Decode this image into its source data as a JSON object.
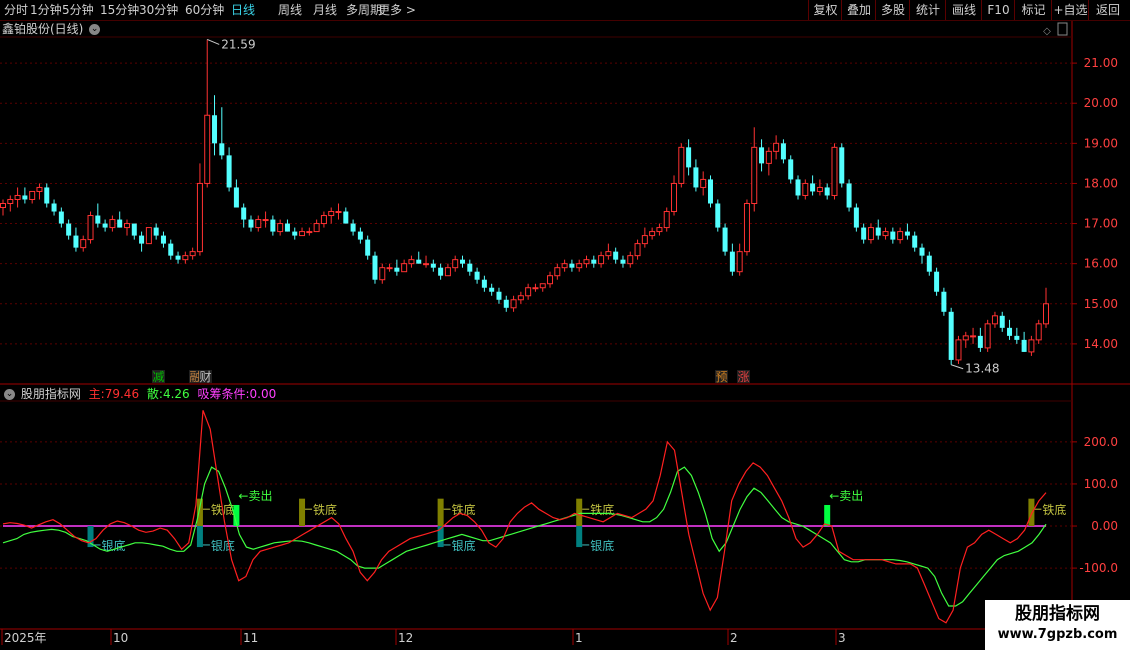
{
  "toolbar": {
    "periods": [
      "分时",
      "1分钟",
      "5分钟",
      "15分钟",
      "30分钟",
      "60分钟",
      "日线",
      "周线",
      "月线",
      "多周期",
      "更多 >"
    ],
    "active_period": "日线",
    "actions": [
      "复权",
      "叠加",
      "多股",
      "统计",
      "画线",
      "F10",
      "标记",
      "+自选",
      "返回"
    ]
  },
  "main_header": {
    "title": "鑫铂股份(日线)"
  },
  "price_axis": {
    "ticks": [
      "21.00",
      "20.00",
      "19.00",
      "18.00",
      "17.00",
      "16.00",
      "15.00",
      "14.00"
    ]
  },
  "price_labels": {
    "high": "21.59",
    "low": "13.48"
  },
  "event_markers": [
    {
      "text": "减",
      "color": "#00c000"
    },
    {
      "text": "融",
      "color": "#c08040"
    },
    {
      "text": "财",
      "color": "#c0c0c0"
    },
    {
      "text": "预",
      "color": "#d08020"
    },
    {
      "text": "涨",
      "color": "#e04040"
    }
  ],
  "indicator_header": {
    "name": "股朋指标网",
    "main_label": "主:",
    "main_value": "79.46",
    "retail_label": "散:",
    "retail_value": "4.26",
    "absorb_label": "吸筹条件:",
    "absorb_value": "0.00"
  },
  "indicator_axis": {
    "ticks": [
      "200.0",
      "100.0",
      "0.00",
      "-100.0"
    ]
  },
  "indicator_labels": {
    "sell": "←卖出",
    "iron": "铁底",
    "silver": "银底"
  },
  "date_axis": {
    "labels": [
      "2025年",
      "10",
      "11",
      "12",
      "1",
      "2",
      "3"
    ]
  },
  "watermark": {
    "line1": "股朋指标网",
    "line2": "www.7gpzb.com"
  },
  "colors": {
    "up": "#ff3232",
    "down": "#54ffff",
    "main_line": "#ff2020",
    "retail_line": "#40ff40",
    "absorb_line": "#ff40ff",
    "iron_bar": "#808000",
    "silver_bar": "#008080",
    "sell_bar": "#00ff40",
    "grid": "#5a0000"
  },
  "chart_data": [
    {
      "type": "candlestick",
      "title": "鑫铂股份(日线)",
      "ylim": [
        13.0,
        22.0
      ],
      "ohlc": [
        [
          17.4,
          17.6,
          17.2,
          17.5
        ],
        [
          17.5,
          17.7,
          17.3,
          17.6
        ],
        [
          17.6,
          17.9,
          17.4,
          17.7
        ],
        [
          17.7,
          17.9,
          17.5,
          17.6
        ],
        [
          17.6,
          17.8,
          17.5,
          17.8
        ],
        [
          17.8,
          18.0,
          17.6,
          17.9
        ],
        [
          17.9,
          18.0,
          17.4,
          17.5
        ],
        [
          17.5,
          17.6,
          17.2,
          17.3
        ],
        [
          17.3,
          17.4,
          16.9,
          17.0
        ],
        [
          17.0,
          17.1,
          16.6,
          16.7
        ],
        [
          16.7,
          16.9,
          16.3,
          16.4
        ],
        [
          16.4,
          16.7,
          16.3,
          16.6
        ],
        [
          16.6,
          17.3,
          16.5,
          17.2
        ],
        [
          17.2,
          17.5,
          16.9,
          17.0
        ],
        [
          17.0,
          17.1,
          16.8,
          16.9
        ],
        [
          16.9,
          17.2,
          16.8,
          17.1
        ],
        [
          17.1,
          17.3,
          16.9,
          16.9
        ],
        [
          16.9,
          17.1,
          16.7,
          17.0
        ],
        [
          17.0,
          17.0,
          16.6,
          16.7
        ],
        [
          16.7,
          16.8,
          16.3,
          16.5
        ],
        [
          16.5,
          16.9,
          16.5,
          16.9
        ],
        [
          16.9,
          17.0,
          16.6,
          16.7
        ],
        [
          16.7,
          16.8,
          16.4,
          16.5
        ],
        [
          16.5,
          16.6,
          16.1,
          16.2
        ],
        [
          16.2,
          16.3,
          16.0,
          16.1
        ],
        [
          16.1,
          16.3,
          16.0,
          16.2
        ],
        [
          16.2,
          16.4,
          16.1,
          16.3
        ],
        [
          16.3,
          18.5,
          16.2,
          18.0
        ],
        [
          18.0,
          21.59,
          17.9,
          19.7
        ],
        [
          19.7,
          20.2,
          18.7,
          19.0
        ],
        [
          19.0,
          19.9,
          18.6,
          18.7
        ],
        [
          18.7,
          18.9,
          17.8,
          17.9
        ],
        [
          17.9,
          18.1,
          17.4,
          17.4
        ],
        [
          17.4,
          17.5,
          16.9,
          17.1
        ],
        [
          17.1,
          17.2,
          16.8,
          16.9
        ],
        [
          16.9,
          17.2,
          16.8,
          17.1
        ],
        [
          17.1,
          17.3,
          16.9,
          17.1
        ],
        [
          17.1,
          17.2,
          16.7,
          16.8
        ],
        [
          16.8,
          17.1,
          16.7,
          17.0
        ],
        [
          17.0,
          17.1,
          16.8,
          16.8
        ],
        [
          16.8,
          16.9,
          16.6,
          16.7
        ],
        [
          16.7,
          16.9,
          16.7,
          16.8
        ],
        [
          16.8,
          16.9,
          16.7,
          16.8
        ],
        [
          16.8,
          17.1,
          16.8,
          17.0
        ],
        [
          17.0,
          17.3,
          16.9,
          17.2
        ],
        [
          17.2,
          17.4,
          17.0,
          17.3
        ],
        [
          17.3,
          17.5,
          17.1,
          17.3
        ],
        [
          17.3,
          17.4,
          17.0,
          17.0
        ],
        [
          17.0,
          17.1,
          16.7,
          16.8
        ],
        [
          16.8,
          16.9,
          16.5,
          16.6
        ],
        [
          16.6,
          16.7,
          16.1,
          16.2
        ],
        [
          16.2,
          16.3,
          15.5,
          15.6
        ],
        [
          15.6,
          16.0,
          15.5,
          15.9
        ],
        [
          15.9,
          16.0,
          15.8,
          15.9
        ],
        [
          15.9,
          16.1,
          15.7,
          15.8
        ],
        [
          15.8,
          16.1,
          15.8,
          16.0
        ],
        [
          16.0,
          16.2,
          15.9,
          16.1
        ],
        [
          16.1,
          16.3,
          16.0,
          16.0
        ],
        [
          16.0,
          16.2,
          15.9,
          16.0
        ],
        [
          16.0,
          16.1,
          15.8,
          15.9
        ],
        [
          15.9,
          16.0,
          15.6,
          15.7
        ],
        [
          15.7,
          16.0,
          15.7,
          15.9
        ],
        [
          15.9,
          16.2,
          15.8,
          16.1
        ],
        [
          16.1,
          16.2,
          15.9,
          16.0
        ],
        [
          16.0,
          16.1,
          15.7,
          15.8
        ],
        [
          15.8,
          15.9,
          15.5,
          15.6
        ],
        [
          15.6,
          15.7,
          15.3,
          15.4
        ],
        [
          15.4,
          15.5,
          15.2,
          15.3
        ],
        [
          15.3,
          15.4,
          15.0,
          15.1
        ],
        [
          15.1,
          15.2,
          14.8,
          14.9
        ],
        [
          14.9,
          15.2,
          14.8,
          15.1
        ],
        [
          15.1,
          15.3,
          15.0,
          15.2
        ],
        [
          15.2,
          15.5,
          15.1,
          15.4
        ],
        [
          15.4,
          15.5,
          15.3,
          15.4
        ],
        [
          15.4,
          15.5,
          15.3,
          15.5
        ],
        [
          15.5,
          15.8,
          15.4,
          15.7
        ],
        [
          15.7,
          16.0,
          15.6,
          15.9
        ],
        [
          15.9,
          16.1,
          15.8,
          16.0
        ],
        [
          16.0,
          16.1,
          15.8,
          15.9
        ],
        [
          15.9,
          16.1,
          15.8,
          16.0
        ],
        [
          16.0,
          16.2,
          15.9,
          16.1
        ],
        [
          16.1,
          16.2,
          15.9,
          16.0
        ],
        [
          16.0,
          16.3,
          15.9,
          16.2
        ],
        [
          16.2,
          16.5,
          16.1,
          16.3
        ],
        [
          16.3,
          16.4,
          16.0,
          16.1
        ],
        [
          16.1,
          16.2,
          15.9,
          16.0
        ],
        [
          16.0,
          16.3,
          15.9,
          16.2
        ],
        [
          16.2,
          16.6,
          16.1,
          16.5
        ],
        [
          16.5,
          16.9,
          16.4,
          16.7
        ],
        [
          16.7,
          16.9,
          16.6,
          16.8
        ],
        [
          16.8,
          17.0,
          16.7,
          16.9
        ],
        [
          16.9,
          17.4,
          16.8,
          17.3
        ],
        [
          17.3,
          18.2,
          17.2,
          18.0
        ],
        [
          18.0,
          19.0,
          17.9,
          18.9
        ],
        [
          18.9,
          19.1,
          18.2,
          18.4
        ],
        [
          18.4,
          18.6,
          17.8,
          17.9
        ],
        [
          17.9,
          18.3,
          17.7,
          18.1
        ],
        [
          18.1,
          18.2,
          17.4,
          17.5
        ],
        [
          17.5,
          17.6,
          16.8,
          16.9
        ],
        [
          16.9,
          17.0,
          16.2,
          16.3
        ],
        [
          16.3,
          16.5,
          15.7,
          15.8
        ],
        [
          15.8,
          16.5,
          15.7,
          16.3
        ],
        [
          16.3,
          17.6,
          16.2,
          17.5
        ],
        [
          17.5,
          19.4,
          17.3,
          18.9
        ],
        [
          18.9,
          19.1,
          18.3,
          18.5
        ],
        [
          18.5,
          18.9,
          18.2,
          18.8
        ],
        [
          18.8,
          19.2,
          18.6,
          19.0
        ],
        [
          19.0,
          19.1,
          18.5,
          18.6
        ],
        [
          18.6,
          18.7,
          18.0,
          18.1
        ],
        [
          18.1,
          18.2,
          17.6,
          17.7
        ],
        [
          17.7,
          18.1,
          17.6,
          18.0
        ],
        [
          18.0,
          18.2,
          17.7,
          17.8
        ],
        [
          17.8,
          18.1,
          17.7,
          17.9
        ],
        [
          17.9,
          18.0,
          17.6,
          17.7
        ],
        [
          17.7,
          19.0,
          17.6,
          18.9
        ],
        [
          18.9,
          19.0,
          17.9,
          18.0
        ],
        [
          18.0,
          18.1,
          17.3,
          17.4
        ],
        [
          17.4,
          17.5,
          16.8,
          16.9
        ],
        [
          16.9,
          17.0,
          16.5,
          16.6
        ],
        [
          16.6,
          17.0,
          16.5,
          16.9
        ],
        [
          16.9,
          17.1,
          16.6,
          16.7
        ],
        [
          16.7,
          16.9,
          16.6,
          16.8
        ],
        [
          16.8,
          16.9,
          16.5,
          16.6
        ],
        [
          16.6,
          16.9,
          16.5,
          16.8
        ],
        [
          16.8,
          17.0,
          16.6,
          16.7
        ],
        [
          16.7,
          16.8,
          16.3,
          16.4
        ],
        [
          16.4,
          16.5,
          16.0,
          16.2
        ],
        [
          16.2,
          16.3,
          15.7,
          15.8
        ],
        [
          15.8,
          15.9,
          15.2,
          15.3
        ],
        [
          15.3,
          15.4,
          14.7,
          14.8
        ],
        [
          14.8,
          14.9,
          13.48,
          13.6
        ],
        [
          13.6,
          14.2,
          13.5,
          14.1
        ],
        [
          14.1,
          14.3,
          13.9,
          14.2
        ],
        [
          14.2,
          14.4,
          14.0,
          14.2
        ],
        [
          14.2,
          14.4,
          13.8,
          13.9
        ],
        [
          13.9,
          14.6,
          13.8,
          14.5
        ],
        [
          14.5,
          14.8,
          14.4,
          14.7
        ],
        [
          14.7,
          14.8,
          14.3,
          14.4
        ],
        [
          14.4,
          14.6,
          14.1,
          14.2
        ],
        [
          14.2,
          14.4,
          14.0,
          14.1
        ],
        [
          14.1,
          14.3,
          13.8,
          13.8
        ],
        [
          13.8,
          14.2,
          13.7,
          14.1
        ],
        [
          14.1,
          14.6,
          14.0,
          14.5
        ],
        [
          14.5,
          15.4,
          14.4,
          15.0
        ]
      ]
    },
    {
      "type": "line",
      "title": "股朋指标网",
      "ylim": [
        -240,
        290
      ],
      "series": [
        {
          "name": "主",
          "values": [
            5,
            8,
            6,
            2,
            -5,
            3,
            10,
            15,
            5,
            -10,
            -25,
            -35,
            -40,
            -30,
            -10,
            5,
            12,
            8,
            0,
            -10,
            -15,
            -12,
            -5,
            -10,
            -30,
            -55,
            -40,
            50,
            275,
            230,
            120,
            10,
            -80,
            -130,
            -120,
            -80,
            -60,
            -55,
            -50,
            -45,
            -40,
            -30,
            -20,
            -10,
            0,
            10,
            20,
            5,
            -30,
            -60,
            -110,
            -130,
            -110,
            -80,
            -60,
            -50,
            -40,
            -30,
            -25,
            -20,
            -15,
            -10,
            5,
            20,
            30,
            25,
            10,
            -10,
            -40,
            -50,
            -30,
            10,
            30,
            45,
            55,
            40,
            30,
            20,
            15,
            20,
            30,
            25,
            20,
            15,
            10,
            20,
            30,
            25,
            20,
            30,
            40,
            60,
            120,
            200,
            180,
            80,
            -20,
            -90,
            -160,
            -200,
            -170,
            -60,
            60,
            100,
            130,
            150,
            140,
            120,
            90,
            60,
            20,
            -30,
            -50,
            -40,
            -20,
            5,
            0,
            -60,
            -70,
            -80,
            -80,
            -80,
            -80,
            -80,
            -85,
            -90,
            -90,
            -90,
            -100,
            -140,
            -180,
            -220,
            -230,
            -200,
            -100,
            -50,
            -40,
            -20,
            -10,
            -20,
            -30,
            -40,
            -30,
            -10,
            30,
            60,
            79.46
          ]
        },
        {
          "name": "散",
          "values": [
            -40,
            -35,
            -30,
            -20,
            -15,
            -12,
            -10,
            -8,
            -10,
            -15,
            -25,
            -30,
            -35,
            -45,
            -55,
            -60,
            -55,
            -50,
            -45,
            -40,
            -40,
            -42,
            -45,
            -48,
            -55,
            -60,
            -60,
            -45,
            20,
            100,
            140,
            130,
            90,
            40,
            -20,
            -50,
            -55,
            -50,
            -45,
            -40,
            -38,
            -36,
            -35,
            -36,
            -40,
            -45,
            -50,
            -55,
            -60,
            -70,
            -80,
            -95,
            -100,
            -100,
            -100,
            -90,
            -80,
            -70,
            -60,
            -55,
            -50,
            -45,
            -40,
            -35,
            -30,
            -25,
            -20,
            -25,
            -30,
            -35,
            -35,
            -30,
            -25,
            -20,
            -15,
            -10,
            -5,
            0,
            5,
            10,
            15,
            20,
            25,
            30,
            30,
            30,
            30,
            30,
            28,
            25,
            20,
            15,
            10,
            10,
            20,
            40,
            80,
            130,
            140,
            120,
            80,
            30,
            -30,
            -60,
            -40,
            0,
            40,
            70,
            90,
            80,
            60,
            40,
            20,
            10,
            5,
            0,
            -10,
            -20,
            -30,
            -40,
            -60,
            -80,
            -85,
            -85,
            -80,
            -80,
            -80,
            -80,
            -80,
            -82,
            -85,
            -90,
            -95,
            -100,
            -120,
            -160,
            -190,
            -190,
            -180,
            -160,
            -140,
            -120,
            -100,
            -80,
            -70,
            -65,
            -60,
            -50,
            -40,
            -20,
            4.26
          ]
        },
        {
          "name": "吸筹条件",
          "values": [
            0
          ]
        }
      ]
    }
  ]
}
